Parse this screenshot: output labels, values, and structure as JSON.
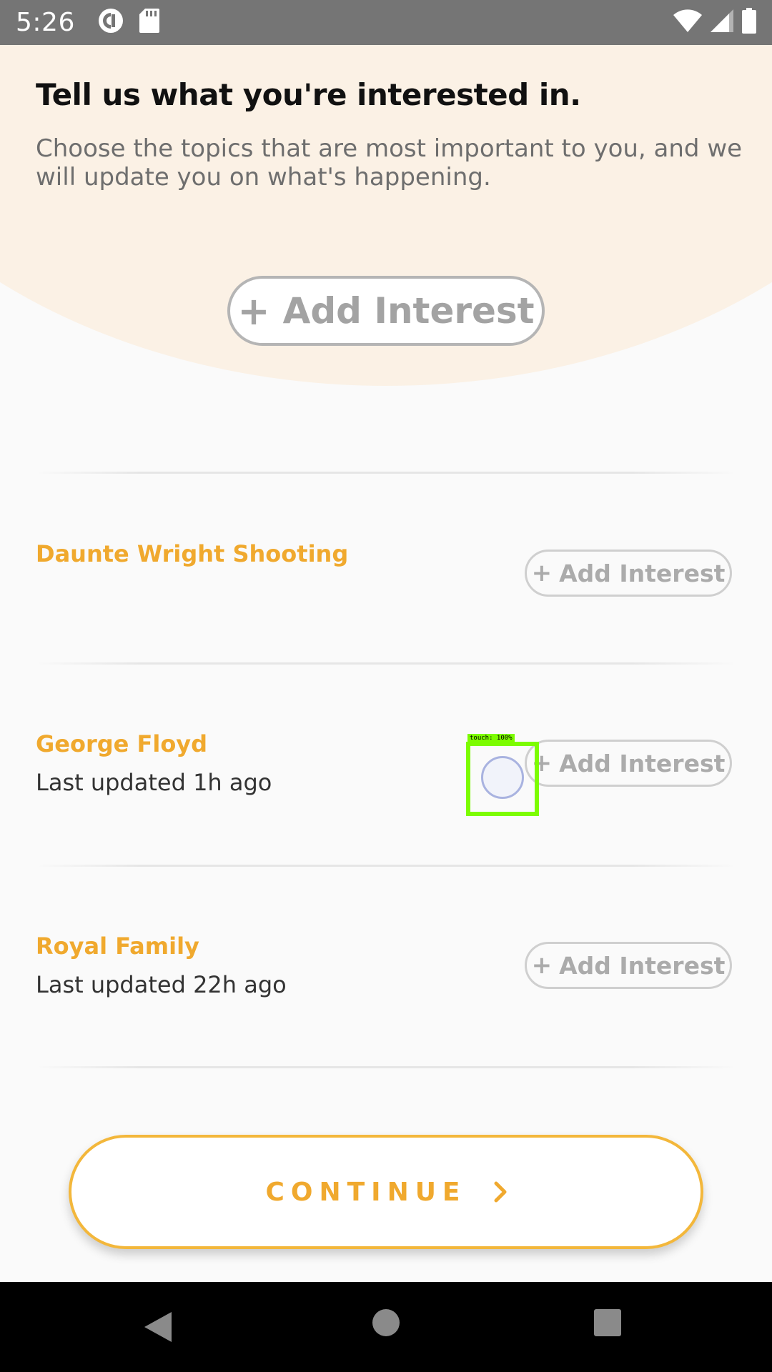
{
  "status_bar": {
    "time": "5:26",
    "icons": [
      "pocket-casts-icon",
      "sd-card-icon",
      "wifi-icon",
      "cell-signal-icon",
      "battery-icon"
    ]
  },
  "header": {
    "title": "Tell us what you're interested in.",
    "subtitle": "Choose the topics that are most important to you, and we will update you on what's happening.",
    "add_interest_label": "Add Interest"
  },
  "topics": [
    {
      "title": "Daunte Wright Shooting",
      "subtitle": "",
      "add_label": "Add Interest"
    },
    {
      "title": "George Floyd",
      "subtitle": "Last updated 1h ago",
      "add_label": "Add Interest"
    },
    {
      "title": "Royal Family",
      "subtitle": "Last updated 22h ago",
      "add_label": "Add Interest"
    }
  ],
  "touch_overlay": {
    "label": "touch: 100%"
  },
  "continue_label": "CONTINUE",
  "colors": {
    "accent": "#F0A92E",
    "hero_bg": "#FBF1E5",
    "status_bar": "#757575",
    "nav_bar": "#000000",
    "touch_indicator": "#7CFC00"
  }
}
